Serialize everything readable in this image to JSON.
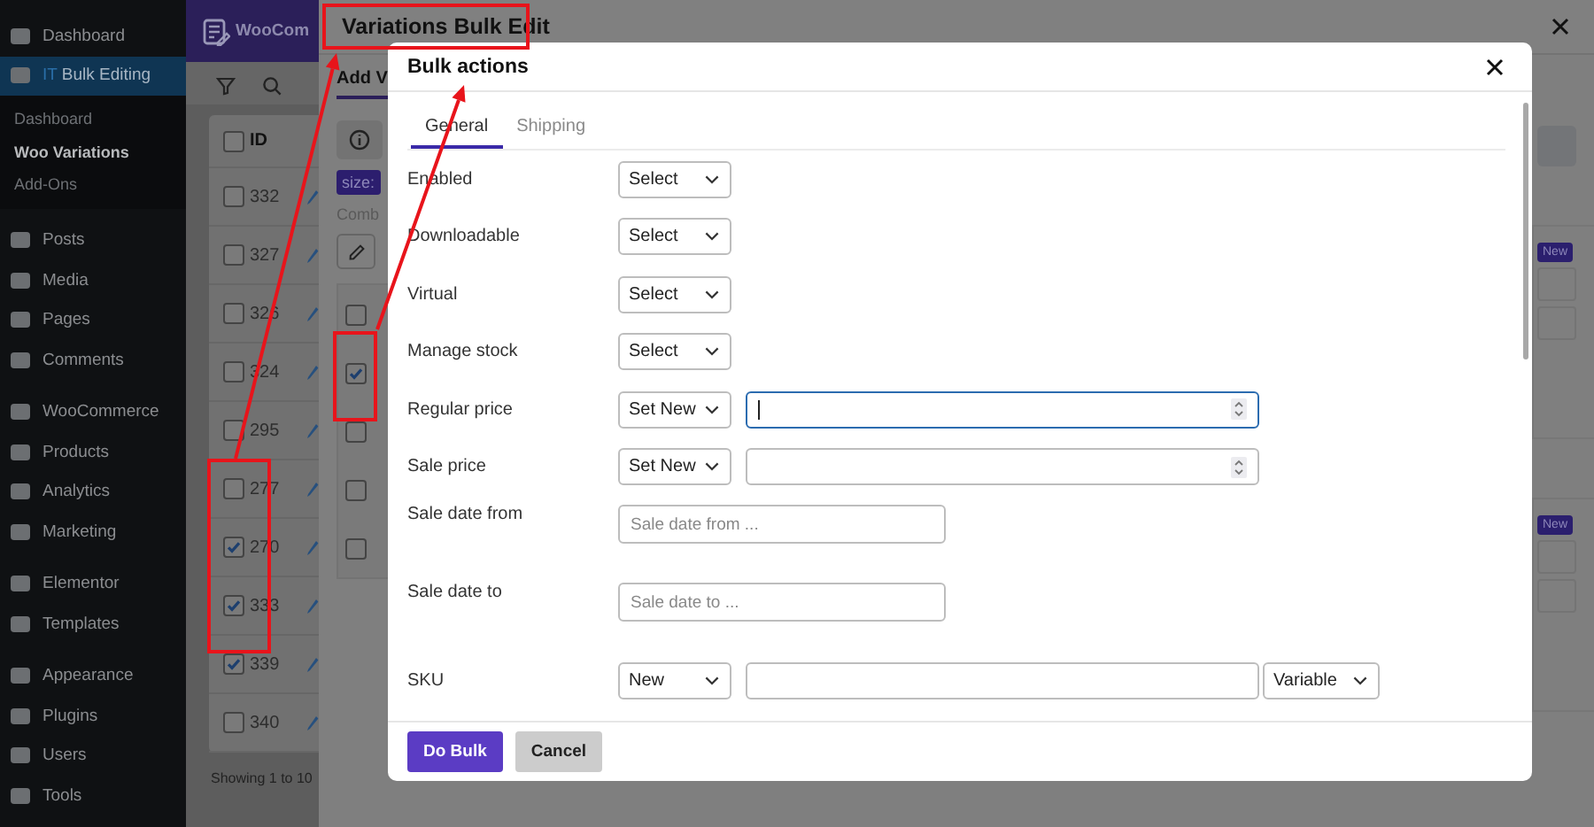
{
  "admin_menu": {
    "groups": [
      [
        {
          "label": "Dashboard",
          "selected": false
        },
        {
          "brand": "IT",
          "label": "Bulk Editing",
          "selected": true,
          "children": [
            {
              "label": "Dashboard",
              "selected": false
            },
            {
              "label": "Woo Variations",
              "selected": true
            },
            {
              "label": "Add-Ons",
              "selected": false
            }
          ]
        }
      ],
      [
        {
          "label": "Posts",
          "selected": false
        },
        {
          "label": "Media",
          "selected": false
        },
        {
          "label": "Pages",
          "selected": false
        },
        {
          "label": "Comments",
          "selected": false
        }
      ],
      [
        {
          "label": "WooCommerce",
          "selected": false
        },
        {
          "label": "Products",
          "selected": false
        },
        {
          "label": "Analytics",
          "selected": false
        },
        {
          "label": "Marketing",
          "selected": false
        }
      ],
      [
        {
          "label": "Elementor",
          "selected": false
        },
        {
          "label": "Templates",
          "selected": false
        }
      ],
      [
        {
          "label": "Appearance",
          "selected": false
        },
        {
          "label": "Plugins",
          "selected": false
        },
        {
          "label": "Users",
          "selected": false
        },
        {
          "label": "Tools",
          "selected": false
        }
      ]
    ]
  },
  "app": {
    "title": "WooCom",
    "table": {
      "columns": [
        {
          "label": "ID",
          "checked": false
        }
      ],
      "rows": [
        {
          "id": "332",
          "checked": false
        },
        {
          "id": "327",
          "checked": false
        },
        {
          "id": "326",
          "checked": false
        },
        {
          "id": "324",
          "checked": false
        },
        {
          "id": "295",
          "checked": false
        },
        {
          "id": "277",
          "checked": false
        },
        {
          "id": "270",
          "checked": true
        },
        {
          "id": "333",
          "checked": true
        },
        {
          "id": "339",
          "checked": true
        },
        {
          "id": "340",
          "checked": false
        }
      ],
      "footer": "Showing 1 to 10"
    }
  },
  "variations_sheet": {
    "title": "Variations Bulk Edit",
    "tab": "Add V",
    "tag": "size:",
    "caption": "Comb",
    "items": [
      {
        "checked": false
      },
      {
        "checked": true
      },
      {
        "checked": false
      },
      {
        "checked": false
      },
      {
        "checked": false
      }
    ],
    "badges": [
      "New",
      "New"
    ]
  },
  "bulk_actions": {
    "title": "Bulk actions",
    "tabs": [
      {
        "label": "General",
        "selected": true
      },
      {
        "label": "Shipping",
        "selected": false
      }
    ],
    "fields": [
      {
        "kind": "select",
        "label": "Enabled",
        "value": "Select"
      },
      {
        "kind": "select",
        "label": "Downloadable",
        "value": "Select"
      },
      {
        "kind": "select",
        "label": "Virtual",
        "value": "Select"
      },
      {
        "kind": "select",
        "label": "Manage stock",
        "value": "Select"
      },
      {
        "kind": "number",
        "label": "Regular price",
        "value": "Set New",
        "focused": true
      },
      {
        "kind": "number",
        "label": "Sale price",
        "value": "Set New",
        "focused": false
      },
      {
        "kind": "date",
        "label": "Sale date from",
        "placeholder": "Sale date from ..."
      },
      {
        "kind": "date",
        "label": "Sale date to",
        "placeholder": "Sale date to ..."
      },
      {
        "kind": "sku",
        "label": "SKU",
        "value": "New",
        "value_2": "Variable"
      }
    ],
    "buttons": [
      {
        "label": "Do Bulk",
        "kind": "primary"
      },
      {
        "label": "Cancel",
        "kind": "secondary"
      }
    ]
  }
}
